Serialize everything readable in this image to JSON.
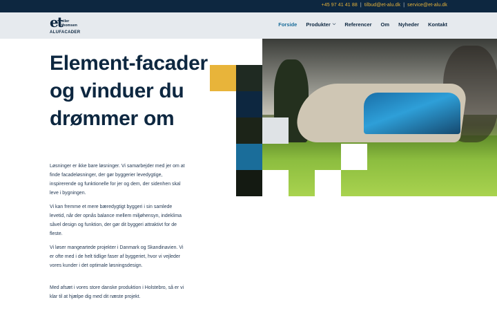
{
  "topbar": {
    "phone": "+45 97 41 41 88",
    "separator": "|",
    "email_bid": "tilbud@et-alu.dk",
    "email_service": "service@et-alu.dk"
  },
  "logo": {
    "mark": "et",
    "name_line1": "eiler",
    "name_line2": "thomsen",
    "subtitle": "ALUFACADER"
  },
  "nav": {
    "items": [
      {
        "label": "Forside",
        "active": true
      },
      {
        "label": "Produkter",
        "dropdown": true,
        "icon": "chevron-down-icon"
      },
      {
        "label": "Referencer"
      },
      {
        "label": "Om"
      },
      {
        "label": "Nyheder"
      },
      {
        "label": "Kontakt"
      }
    ]
  },
  "hero": {
    "title": "Element-facader og vinduer du drømmer om",
    "paragraphs": [
      "Løsninger er ikke bare løsninger. Vi samarbejder med jer om at finde facadeløsninger, der gør byggerier levedygtige, inspirerende og funktionelle for jer og dem, der sidenhen skal leve i bygningen.",
      "Vi kan fremme et mere bæredygtigt byggeri i sin samlede levetid, når der opnås balance mellem miljøhensyn, indeklima såvel design og funktion, der gør dit byggeri attraktivt for de fleste.",
      "Vi løser mangeartede projekter i Danmark og Skandinavien. Vi er ofte med i de helt tidlige faser af byggeriet, hvor vi vejleder vores kunder i det optimale løsningsdesign.",
      "Med afsæt i vores store danske produktion i Holstebro, så er vi klar til at hjælpe dig med dit næste projekt."
    ]
  },
  "colors": {
    "navy": "#0d2740",
    "accent_yellow": "#e8b43a",
    "accent_blue": "#1a6d9a",
    "light_grey": "#e6eaee"
  }
}
